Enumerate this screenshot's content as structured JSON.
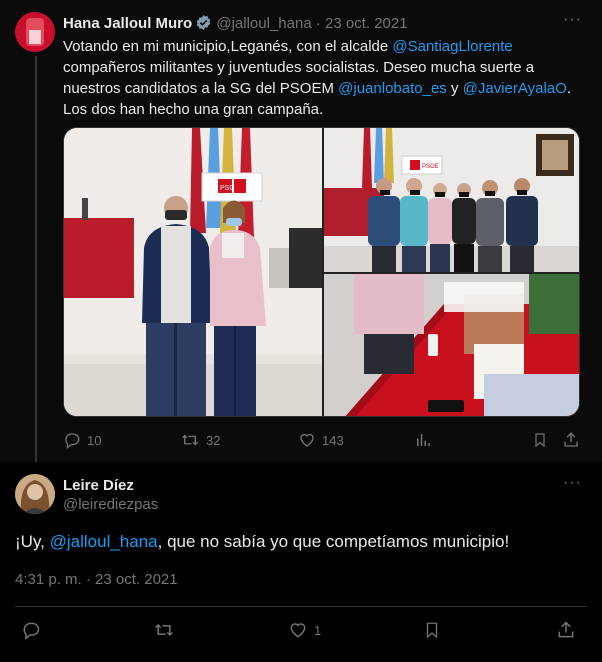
{
  "parent": {
    "author_name": "Hana Jalloul Muro",
    "handle": "@jalloul_hana",
    "separator": "·",
    "date": "23 oct. 2021",
    "text_parts": [
      {
        "t": "Votando en mi municipio,Leganés, con el alcalde ",
        "link": false
      },
      {
        "t": "@SantiagLlorente",
        "link": true
      },
      {
        "t": " compañeros militantes y juventudes socialistas. Deseo mucha suerte a nuestros candidatos a la SG del PSOEM ",
        "link": false
      },
      {
        "t": "@juanlobato_es",
        "link": true
      },
      {
        "t": " y ",
        "link": false
      },
      {
        "t": "@JavierAyalaO",
        "link": true
      },
      {
        "t": ". Los dos han hecho una gran campaña.",
        "link": false
      }
    ],
    "photo_1_sign": "PSOE",
    "photo_2_sign": "PSOE",
    "stats": {
      "replies": "10",
      "reposts": "32",
      "likes": "143"
    },
    "icons": [
      "reply-icon",
      "repost-icon",
      "like-icon",
      "views-icon",
      "bookmark-icon",
      "share-icon",
      "verified-icon",
      "more-icon"
    ]
  },
  "reply": {
    "author_name": "Leire Díez",
    "handle": "@leirediezpas",
    "text_before": "¡Uy, ",
    "mention": "@jalloul_hana",
    "text_after": ", que no sabía yo que competíamos municipio!",
    "time": "4:31 p. m.",
    "separator": "·",
    "date": "23 oct. 2021",
    "stats": {
      "likes": "1"
    }
  },
  "colors": {
    "accent": "#1d9bf0",
    "muted": "#71767b",
    "text": "#e7e9ea",
    "background": "#000000"
  }
}
